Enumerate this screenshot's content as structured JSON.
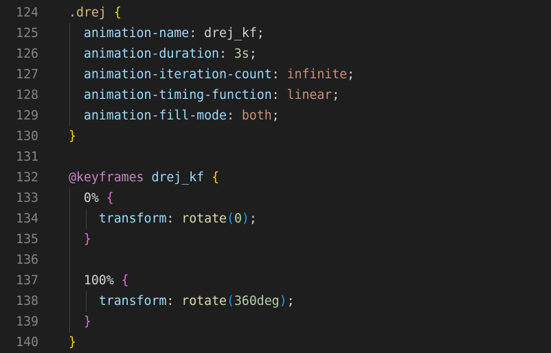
{
  "editor": {
    "language": "css",
    "lines": [
      {
        "number": "124",
        "tokens": [
          {
            "t": ".drej",
            "c": "sel"
          },
          {
            "t": " ",
            "c": "plain"
          },
          {
            "t": "{",
            "c": "b1"
          }
        ]
      },
      {
        "number": "125",
        "tokens": [
          {
            "t": "  ",
            "c": "plain"
          },
          {
            "t": "animation-name",
            "c": "prop"
          },
          {
            "t": ": ",
            "c": "plain"
          },
          {
            "t": "drej_kf",
            "c": "plain"
          },
          {
            "t": ";",
            "c": "plain"
          }
        ]
      },
      {
        "number": "126",
        "tokens": [
          {
            "t": "  ",
            "c": "plain"
          },
          {
            "t": "animation-duration",
            "c": "prop"
          },
          {
            "t": ": ",
            "c": "plain"
          },
          {
            "t": "3s",
            "c": "num"
          },
          {
            "t": ";",
            "c": "plain"
          }
        ]
      },
      {
        "number": "127",
        "tokens": [
          {
            "t": "  ",
            "c": "plain"
          },
          {
            "t": "animation-iteration-count",
            "c": "prop"
          },
          {
            "t": ": ",
            "c": "plain"
          },
          {
            "t": "infinite",
            "c": "val"
          },
          {
            "t": ";",
            "c": "plain"
          }
        ]
      },
      {
        "number": "128",
        "tokens": [
          {
            "t": "  ",
            "c": "plain"
          },
          {
            "t": "animation-timing-function",
            "c": "prop"
          },
          {
            "t": ": ",
            "c": "plain"
          },
          {
            "t": "linear",
            "c": "val"
          },
          {
            "t": ";",
            "c": "plain"
          }
        ]
      },
      {
        "number": "129",
        "tokens": [
          {
            "t": "  ",
            "c": "plain"
          },
          {
            "t": "animation-fill-mode",
            "c": "prop"
          },
          {
            "t": ": ",
            "c": "plain"
          },
          {
            "t": "both",
            "c": "val"
          },
          {
            "t": ";",
            "c": "plain"
          }
        ]
      },
      {
        "number": "130",
        "tokens": [
          {
            "t": "}",
            "c": "b1"
          }
        ]
      },
      {
        "number": "131",
        "tokens": []
      },
      {
        "number": "132",
        "tokens": [
          {
            "t": "@keyframes",
            "c": "at"
          },
          {
            "t": " ",
            "c": "plain"
          },
          {
            "t": "drej_kf",
            "c": "kf"
          },
          {
            "t": " ",
            "c": "plain"
          },
          {
            "t": "{",
            "c": "b1"
          }
        ]
      },
      {
        "number": "133",
        "tokens": [
          {
            "t": "  ",
            "c": "plain"
          },
          {
            "t": "0%",
            "c": "plain"
          },
          {
            "t": " ",
            "c": "plain"
          },
          {
            "t": "{",
            "c": "b2"
          }
        ]
      },
      {
        "number": "134",
        "tokens": [
          {
            "t": "    ",
            "c": "plain"
          },
          {
            "t": "transform",
            "c": "prop"
          },
          {
            "t": ": ",
            "c": "plain"
          },
          {
            "t": "rotate",
            "c": "fn"
          },
          {
            "t": "(",
            "c": "b3"
          },
          {
            "t": "0",
            "c": "num"
          },
          {
            "t": ")",
            "c": "b3"
          },
          {
            "t": ";",
            "c": "plain"
          }
        ]
      },
      {
        "number": "135",
        "tokens": [
          {
            "t": "  ",
            "c": "plain"
          },
          {
            "t": "}",
            "c": "b2"
          }
        ]
      },
      {
        "number": "136",
        "tokens": []
      },
      {
        "number": "137",
        "tokens": [
          {
            "t": "  ",
            "c": "plain"
          },
          {
            "t": "100%",
            "c": "plain"
          },
          {
            "t": " ",
            "c": "plain"
          },
          {
            "t": "{",
            "c": "b2"
          }
        ]
      },
      {
        "number": "138",
        "tokens": [
          {
            "t": "    ",
            "c": "plain"
          },
          {
            "t": "transform",
            "c": "prop"
          },
          {
            "t": ": ",
            "c": "plain"
          },
          {
            "t": "rotate",
            "c": "fn"
          },
          {
            "t": "(",
            "c": "b3"
          },
          {
            "t": "360deg",
            "c": "num"
          },
          {
            "t": ")",
            "c": "b3"
          },
          {
            "t": ";",
            "c": "plain"
          }
        ]
      },
      {
        "number": "139",
        "tokens": [
          {
            "t": "  ",
            "c": "plain"
          },
          {
            "t": "}",
            "c": "b2"
          }
        ]
      },
      {
        "number": "140",
        "tokens": [
          {
            "t": "}",
            "c": "b1"
          }
        ]
      }
    ]
  },
  "colors": {
    "background": "#1e1e1e",
    "line_number": "#858585",
    "selector": "#d7ba7d",
    "property": "#9cdcfe",
    "value": "#ce9178",
    "number": "#b5cea8",
    "function": "#dcdcaa",
    "at_rule": "#c586c0",
    "bracket_level_1": "#ffd700",
    "bracket_level_2": "#da70d6",
    "bracket_level_3": "#179fff"
  }
}
